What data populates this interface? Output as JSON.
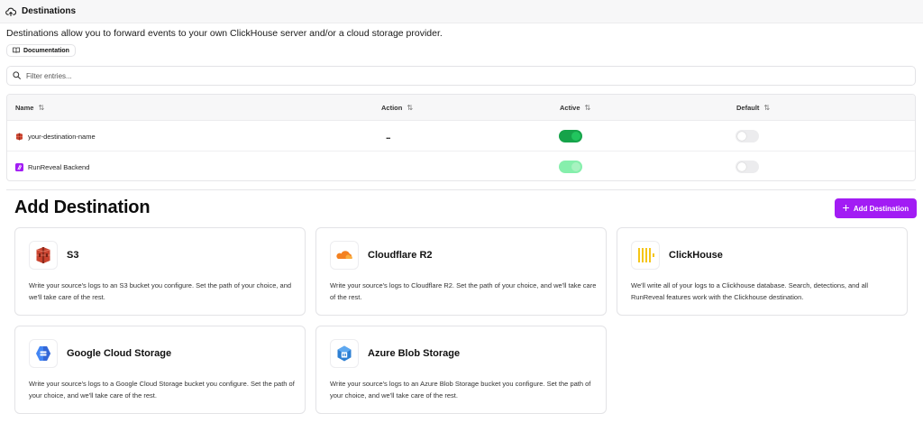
{
  "header": {
    "title": "Destinations",
    "icon": "cloud-upload-icon"
  },
  "description": "Destinations allow you to forward events to your own ClickHouse server and/or a cloud storage provider.",
  "doc_button": {
    "label": "Documentation",
    "icon": "book-icon"
  },
  "filter": {
    "placeholder": "Filter entries...",
    "value": "",
    "icon": "search-icon"
  },
  "table": {
    "columns": [
      {
        "label": "Name"
      },
      {
        "label": "Action"
      },
      {
        "label": "Active"
      },
      {
        "label": "Default"
      }
    ],
    "rows": [
      {
        "name": "your-destination-name",
        "icon": "s3-icon",
        "action": "...",
        "active": true,
        "default": false
      },
      {
        "name": "RunReveal Backend",
        "icon": "runreveal-icon",
        "action": "",
        "active": true,
        "default": false
      }
    ]
  },
  "add_section": {
    "title": "Add Destination",
    "button_label": "Add Destination",
    "button_icon": "plus-icon"
  },
  "cards": [
    {
      "name": "S3",
      "icon": "s3-icon",
      "description": "Write your source's logs to an S3 bucket you configure. Set the path of your choice, and we'll take care of the rest."
    },
    {
      "name": "Cloudflare R2",
      "icon": "cloudflare-icon",
      "description": "Write your source's logs to Cloudflare R2. Set the path of your choice, and we'll take care of the rest."
    },
    {
      "name": "ClickHouse",
      "icon": "clickhouse-icon",
      "description": "We'll write all of your logs to a Clickhouse database. Search, detections, and all RunReveal features work with the Clickhouse destination."
    },
    {
      "name": "Google Cloud Storage",
      "icon": "gcs-icon",
      "description": "Write your source's logs to a Google Cloud Storage bucket you configure. Set the path of your choice, and we'll take care of the rest."
    },
    {
      "name": "Azure Blob Storage",
      "icon": "azure-blob-icon",
      "description": "Write your source's logs to an Azure Blob Storage bucket you configure. Set the path of your choice, and we'll take care of the rest."
    }
  ],
  "colors": {
    "accent": "#a21cf4",
    "toggle_on": "#16a34a",
    "toggle_on_dim": "#86efac",
    "toggle_off": "#ececee"
  }
}
